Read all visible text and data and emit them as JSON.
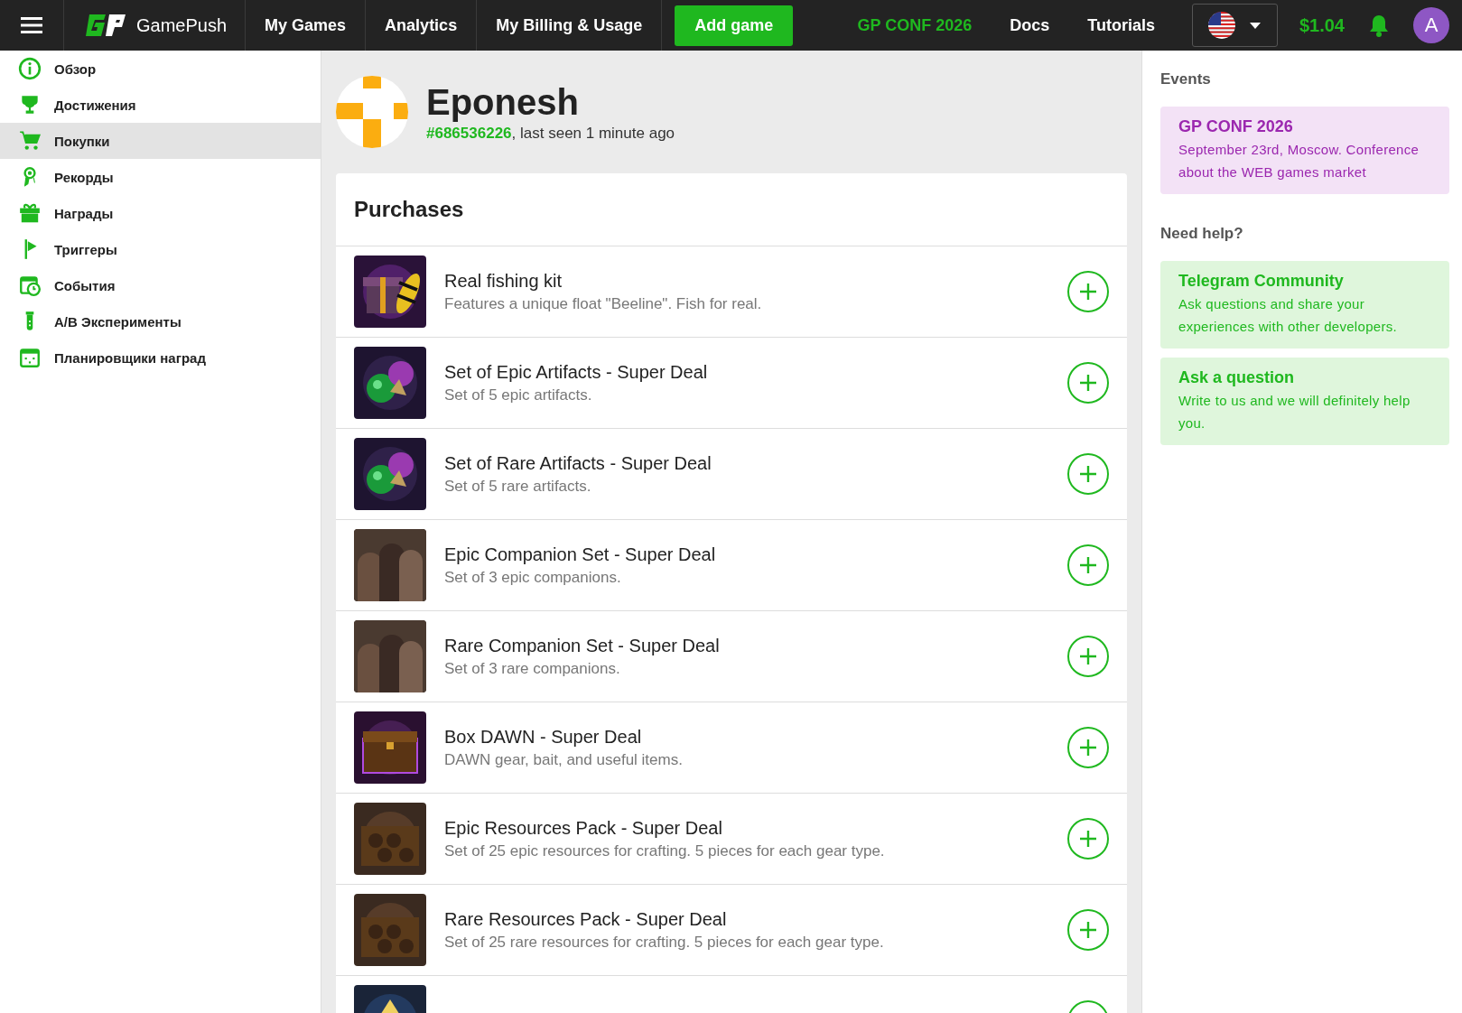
{
  "topbar": {
    "brand": "GamePush",
    "nav": [
      {
        "label": "My Games",
        "kind": "link"
      },
      {
        "label": "Analytics",
        "kind": "link"
      },
      {
        "label": "My Billing & Usage",
        "kind": "link"
      },
      {
        "label": "Add game",
        "kind": "primary"
      }
    ],
    "right_links": [
      {
        "label": "GP CONF 2026",
        "kind": "accent"
      },
      {
        "label": "Docs",
        "kind": "link"
      },
      {
        "label": "Tutorials",
        "kind": "link"
      }
    ],
    "balance": "$1.04",
    "avatar": "A"
  },
  "sidebar": {
    "items": [
      {
        "label": "Обзор",
        "selected": false
      },
      {
        "label": "Достижения",
        "selected": false
      },
      {
        "label": "Покупки",
        "selected": true
      },
      {
        "label": "Рекорды",
        "selected": false
      },
      {
        "label": "Награды",
        "selected": false
      },
      {
        "label": "Триггеры",
        "selected": false
      },
      {
        "label": "События",
        "selected": false
      },
      {
        "label": "A/B Эксперименты",
        "selected": false
      },
      {
        "label": "Планировщики наград",
        "selected": false
      }
    ]
  },
  "player": {
    "name": "Eponesh",
    "id": "#686536226",
    "last_seen": ", last seen 1 minute ago"
  },
  "purchases": {
    "title": "Purchases",
    "items": [
      {
        "title": "Real fishing kit",
        "description": "Features a unique float \"Beeline\". Fish for real."
      },
      {
        "title": "Set of Epic Artifacts - Super Deal",
        "description": "Set of 5 epic artifacts."
      },
      {
        "title": "Set of Rare Artifacts - Super Deal",
        "description": "Set of 5 rare artifacts."
      },
      {
        "title": "Epic Companion Set - Super Deal",
        "description": "Set of 3 epic companions."
      },
      {
        "title": "Rare Companion Set - Super Deal",
        "description": "Set of 3 rare companions."
      },
      {
        "title": "Box DAWN - Super Deal",
        "description": "DAWN gear, bait, and useful items."
      },
      {
        "title": "Epic Resources Pack - Super Deal",
        "description": "Set of 25 epic resources for crafting. 5 pieces for each gear type."
      },
      {
        "title": "Rare Resources Pack - Super Deal",
        "description": "Set of 25 rare resources for crafting. 5 pieces for each gear type."
      }
    ]
  },
  "aside": {
    "events_title": "Events",
    "events": [
      {
        "title": "GP CONF 2026",
        "text": "September 23rd, Moscow. Conference about the WEB games market",
        "color": "#f3e2f6"
      }
    ],
    "help_title": "Need help?",
    "help": [
      {
        "title": "Telegram Community",
        "text": "Ask questions and share your experiences with other developers.",
        "color": "#dff6dc"
      },
      {
        "title": "Ask a question",
        "text": "Write to us and we will definitely help you.",
        "color": "#dff6dc"
      }
    ]
  }
}
